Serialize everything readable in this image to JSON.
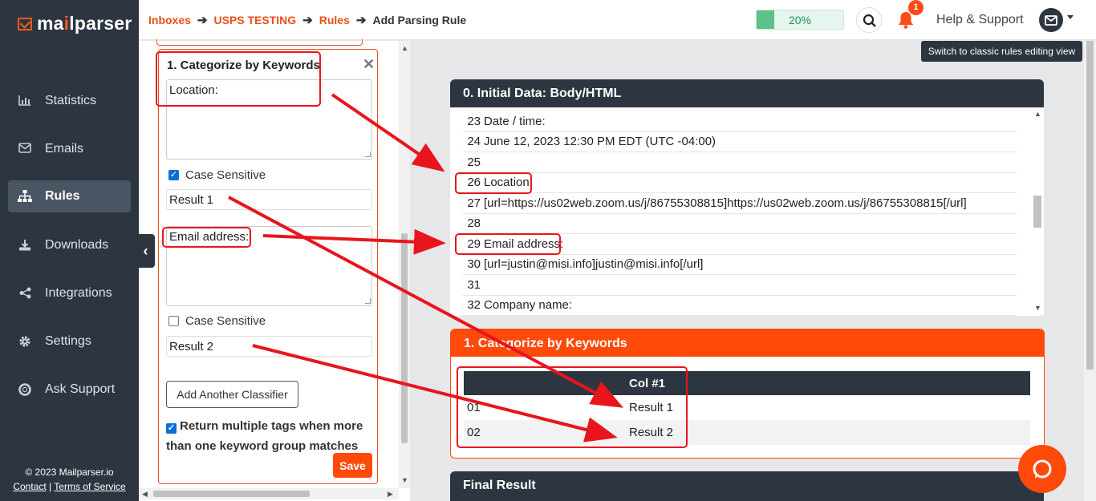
{
  "app": {
    "logo_prefix": "ma",
    "logo_accent": "i",
    "logo_suffix": "lparser"
  },
  "sidebar": {
    "items": [
      {
        "label": "Statistics",
        "icon": "chart-icon"
      },
      {
        "label": "Emails",
        "icon": "envelope-icon"
      },
      {
        "label": "Rules",
        "icon": "sitemap-icon"
      },
      {
        "label": "Downloads",
        "icon": "download-icon"
      },
      {
        "label": "Integrations",
        "icon": "share-icon"
      },
      {
        "label": "Settings",
        "icon": "gear-icon"
      },
      {
        "label": "Ask Support",
        "icon": "help-circle-icon"
      }
    ],
    "active_index": 2,
    "copyright": "© 2023 Mailparser.io",
    "contact_label": "Contact",
    "divider": "|",
    "terms_label": "Terms of Service"
  },
  "header": {
    "breadcrumb": [
      "Inboxes",
      "USPS TESTING",
      "Rules",
      "Add Parsing Rule"
    ],
    "progress_percent": 20,
    "progress_label": "20%",
    "notification_count": "1",
    "help_label": "Help & Support",
    "tooltip": "Switch to classic rules editing view"
  },
  "editor": {
    "card_title": "1. Categorize by Keywords",
    "classifiers": [
      {
        "keywords": "Location:",
        "case_sensitive": true,
        "case_label": "Case Sensitive",
        "result": "Result 1"
      },
      {
        "keywords": "Email address:",
        "case_sensitive": false,
        "case_label": "Case Sensitive",
        "result": "Result 2"
      }
    ],
    "add_button": "Add Another Classifier",
    "multi_tags_checked": true,
    "multi_tags_label": "Return multiple tags when more than one keyword group matches",
    "save_button": "Save"
  },
  "initial_data": {
    "title": "0. Initial Data: Body/HTML",
    "lines": [
      {
        "n": "23",
        "text": "Date / time:"
      },
      {
        "n": "24",
        "text": "June 12, 2023 12:30 PM EDT (UTC -04:00)"
      },
      {
        "n": "25",
        "text": ""
      },
      {
        "n": "26",
        "text": "Location:"
      },
      {
        "n": "27",
        "text": "[url=https://us02web.zoom.us/j/86755308815]https://us02web.zoom.us/j/86755308815[/url]"
      },
      {
        "n": "28",
        "text": ""
      },
      {
        "n": "29",
        "text": "Email address:"
      },
      {
        "n": "30",
        "text": "[url=justin@misi.info]justin@misi.info[/url]"
      },
      {
        "n": "31",
        "text": ""
      },
      {
        "n": "32",
        "text": "Company name:"
      }
    ]
  },
  "categorize": {
    "title": "1. Categorize by Keywords",
    "column_header": "Col #1",
    "rows": [
      {
        "id": "01",
        "value": "Result 1"
      },
      {
        "id": "02",
        "value": "Result 2"
      }
    ]
  },
  "final_result": {
    "title": "Final Result"
  },
  "colors": {
    "accent": "#ff4a0a",
    "sidebar_bg": "#2d3541",
    "annotation_red": "#e8151c"
  }
}
